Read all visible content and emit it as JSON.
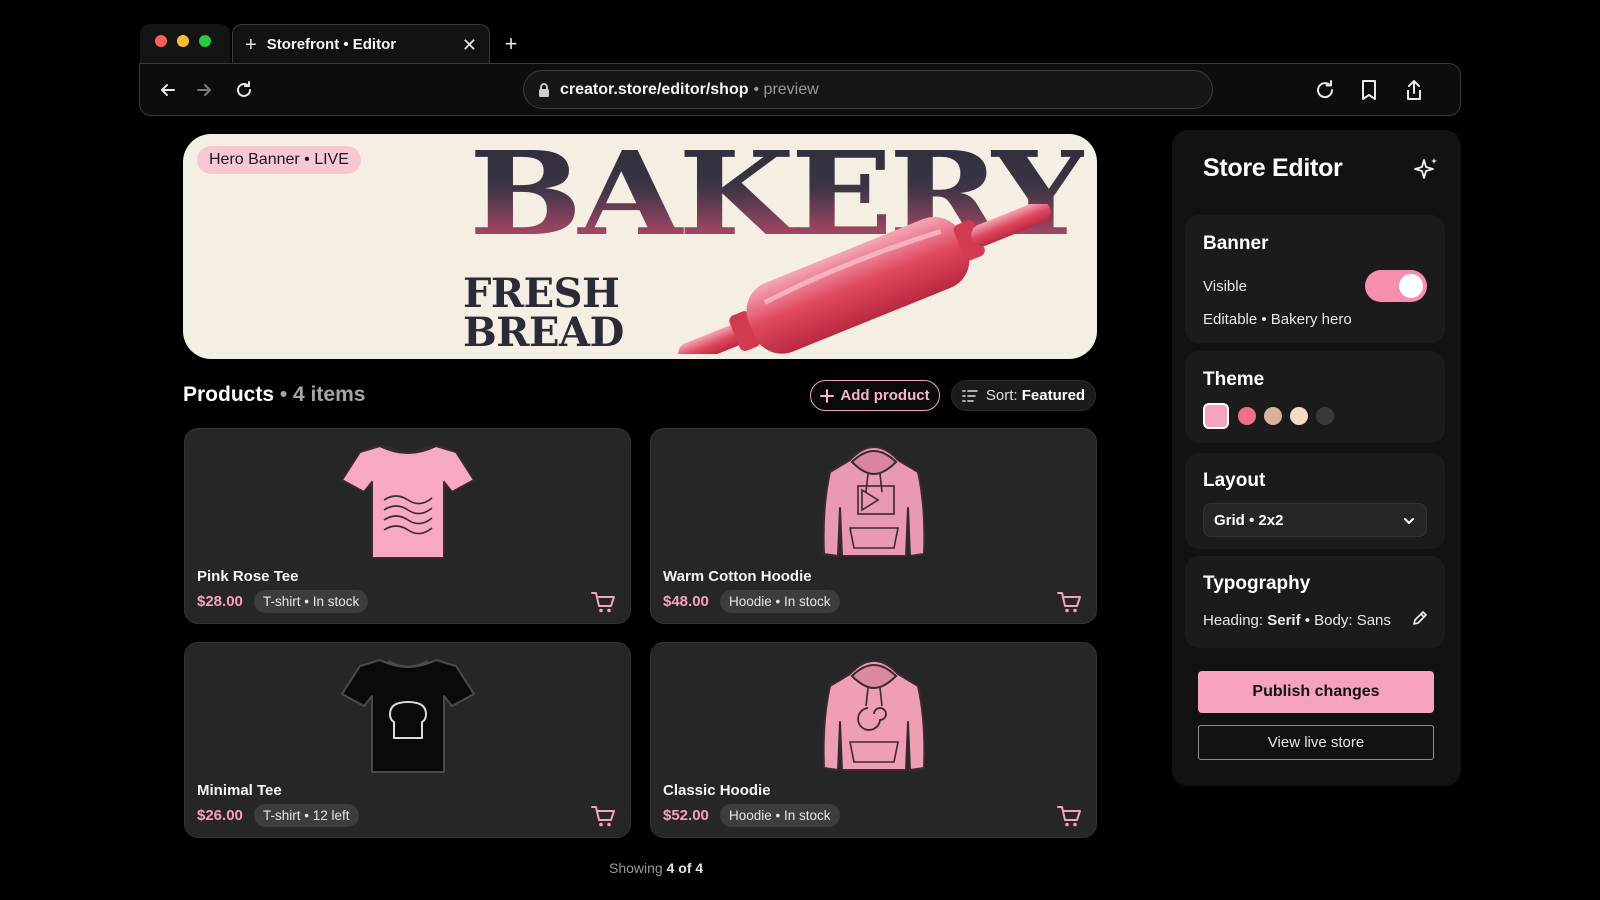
{
  "browser": {
    "tab_title": "Storefront • Editor",
    "url_host": "creator.store/editor/shop",
    "url_suffix": "• preview"
  },
  "hero": {
    "badge": "Hero Banner • LIVE",
    "title": "BAKERY",
    "subtitle_line1": "FRESH",
    "subtitle_line2": "BREAD"
  },
  "products": {
    "heading": "Products",
    "count": "• 4 items",
    "add_label": "Add product",
    "sort_prefix": "Sort:",
    "sort_value": "Featured",
    "items": [
      {
        "name": "Pink Rose Tee",
        "price": "$28.00",
        "tag": "T-shirt • In stock",
        "art": "pink-tshirt"
      },
      {
        "name": "Warm Cotton Hoodie",
        "price": "$48.00",
        "tag": "Hoodie • In stock",
        "art": "pink-hoodie-play"
      },
      {
        "name": "Minimal Tee",
        "price": "$26.00",
        "tag": "T-shirt • 12 left",
        "art": "black-tshirt-bread"
      },
      {
        "name": "Classic Hoodie",
        "price": "$52.00",
        "tag": "Hoodie • In stock",
        "art": "pink-hoodie-swirl"
      }
    ],
    "showing_prefix": "Showing",
    "showing_count": "4 of 4"
  },
  "editor": {
    "title": "Store Editor",
    "banner": {
      "heading": "Banner",
      "visible_label": "Visible",
      "visible": true,
      "meta": "Editable • Bakery hero"
    },
    "theme": {
      "heading": "Theme",
      "swatches": [
        "#f4a3ba",
        "#f26d92",
        "#d9b29b",
        "#f3dcc0",
        "#3a3a3a"
      ],
      "selected_index": 0
    },
    "layout": {
      "heading": "Layout",
      "selected": "Grid • 2x2"
    },
    "typography": {
      "heading": "Typography",
      "heading_label": "Heading:",
      "heading_value": "Serif",
      "body_label": "• Body: Sans"
    },
    "publish_label": "Publish changes",
    "view_label": "View live store"
  },
  "colors": {
    "accent": "#f7a2bb",
    "background": "#000000",
    "card": "#262626",
    "panel": "#121212"
  }
}
